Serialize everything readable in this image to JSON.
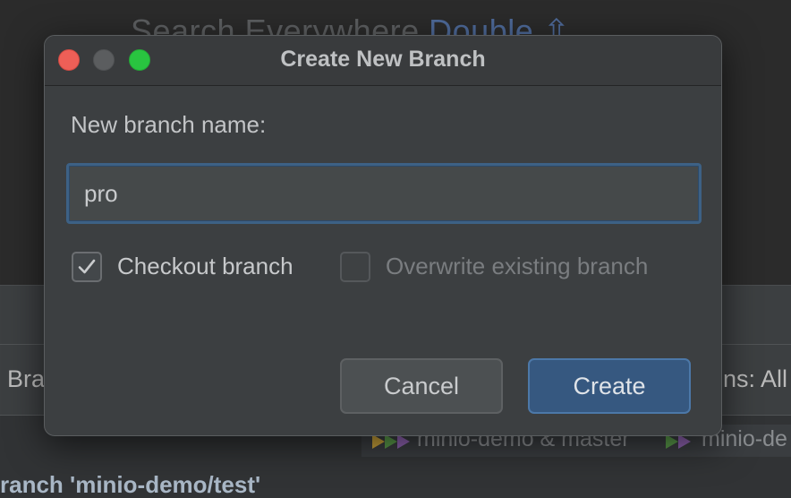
{
  "background": {
    "search_hint": "Search Everywhere",
    "search_hint_key": "Double ⇧",
    "filter_branch_label": "Bra",
    "filter_right_label": "ns: All",
    "refs": [
      {
        "label": "minio-demo & master"
      },
      {
        "label": "minio-de"
      }
    ],
    "commit_message": "ranch 'minio-demo/test'"
  },
  "dialog": {
    "title": "Create New Branch",
    "field_label": "New branch name:",
    "branch_name_value": "pro",
    "checkout_label": "Checkout branch",
    "checkout_checked": true,
    "overwrite_label": "Overwrite existing branch",
    "overwrite_checked": false,
    "cancel_label": "Cancel",
    "create_label": "Create"
  },
  "colors": {
    "accent": "#365880",
    "focus_border": "#3d6185",
    "close": "#ee5f57",
    "maximize": "#29c440"
  }
}
